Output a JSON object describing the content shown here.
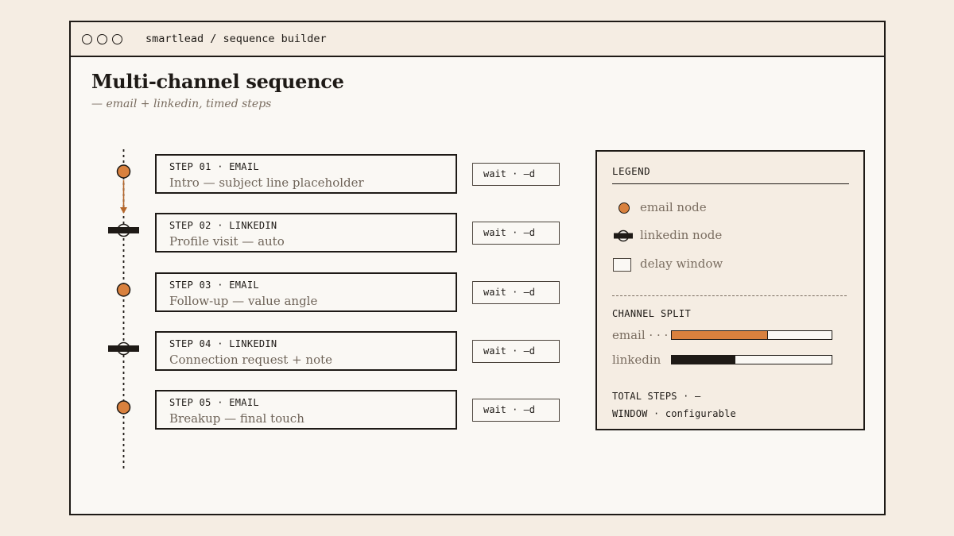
{
  "window": {
    "title": "smartlead / sequence builder"
  },
  "page": {
    "title": "Multi-channel sequence",
    "subtitle": "— email + linkedin, timed steps"
  },
  "steps": [
    {
      "label": "STEP 01 · EMAIL",
      "description": "Intro — subject line placeholder",
      "channel": "email",
      "wait": "wait · —d"
    },
    {
      "label": "STEP 02 · LINKEDIN",
      "description": "Profile visit — auto",
      "channel": "linkedin",
      "wait": "wait · —d"
    },
    {
      "label": "STEP 03 · EMAIL",
      "description": "Follow-up — value angle",
      "channel": "email",
      "wait": "wait · —d"
    },
    {
      "label": "STEP 04 · LINKEDIN",
      "description": "Connection request + note",
      "channel": "linkedin",
      "wait": "wait · —d"
    },
    {
      "label": "STEP 05 · EMAIL",
      "description": "Breakup — final touch",
      "channel": "email",
      "wait": "wait · —d"
    }
  ],
  "legend": {
    "title": "LEGEND",
    "items": [
      {
        "label": "email node",
        "icon": "email-node-icon"
      },
      {
        "label": "linkedin node",
        "icon": "linkedin-node-icon"
      },
      {
        "label": "delay window",
        "icon": "delay-window-icon"
      }
    ],
    "channel_split": {
      "title": "CHANNEL SPLIT",
      "rows": [
        {
          "label": "email · · ·",
          "fraction": 0.6,
          "color": "#d9813e"
        },
        {
          "label": "linkedin",
          "fraction": 0.4,
          "color": "#1e1a16"
        }
      ]
    },
    "total_steps": "TOTAL STEPS · —",
    "window": "WINDOW · configurable"
  },
  "colors": {
    "accent": "#d9813e",
    "ink": "#1e1a16",
    "background": "#f5ede3",
    "panel": "#faf8f4"
  }
}
